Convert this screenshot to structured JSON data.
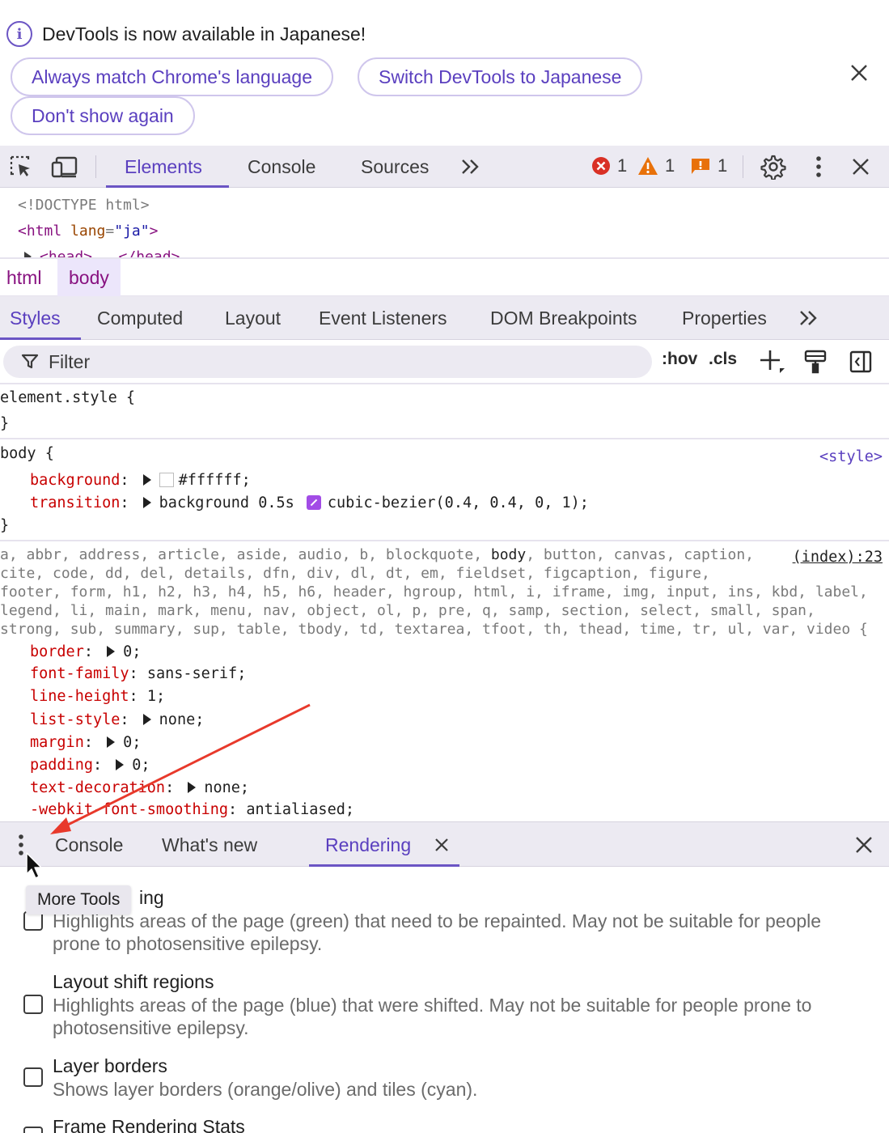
{
  "infobar": {
    "message": "DevTools is now available in Japanese!",
    "btn_always_match": "Always match Chrome's language",
    "btn_switch": "Switch DevTools to Japanese",
    "btn_dont_show": "Don't show again"
  },
  "toolbar": {
    "tabs": [
      "Elements",
      "Console",
      "Sources"
    ],
    "active_tab": "Elements",
    "errors": "1",
    "warnings": "1",
    "issues": "1"
  },
  "dom_tree": {
    "doctype": "<!DOCTYPE html>",
    "html_tag_open": "<html",
    "html_attr": "lang",
    "html_val": "\"ja\"",
    "html_tag_close": ">",
    "head_partial": "<head> … </head>"
  },
  "breadcrumb": [
    "html",
    "body"
  ],
  "subtabs": [
    "Styles",
    "Computed",
    "Layout",
    "Event Listeners",
    "DOM Breakpoints",
    "Properties"
  ],
  "filter": {
    "placeholder": "Filter",
    "hov": ":hov",
    "cls": ".cls"
  },
  "styles": {
    "element_style": "element.style {",
    "close_brace": "}",
    "body_selector": "body {",
    "body_source": "<style>",
    "body_props": [
      {
        "name": "background",
        "value": "#ffffff;"
      },
      {
        "name": "transition",
        "value_a": "background 0.5s",
        "value_b": "cubic-bezier(0.4, 0.4, 0, 1);"
      }
    ],
    "reset_source": "(index):23",
    "reset_selector_lines": [
      "a, abbr, address, article, aside, audio, b, blockquote, ",
      "body",
      ", button, canvas, caption,",
      "cite, code, dd, del, details, dfn, div, dl, dt, em, fieldset, figcaption, figure,",
      "footer, form, h1, h2, h3, h4, h5, h6, header, hgroup, html, i, iframe, img, input, ins, kbd, label,",
      "legend, li, main, mark, menu, nav, object, ol, p, pre, q, samp, section, select, small, span,",
      "strong, sub, summary, sup, table, tbody, td, textarea, tfoot, th, thead, time, tr, ul, var, video {"
    ],
    "reset_props": [
      {
        "name": "border",
        "value": "0;",
        "expand": true
      },
      {
        "name": "font-family",
        "value": "sans-serif;",
        "expand": false
      },
      {
        "name": "line-height",
        "value": "1;",
        "expand": false
      },
      {
        "name": "list-style",
        "value": "none;",
        "expand": true
      },
      {
        "name": "margin",
        "value": "0;",
        "expand": true
      },
      {
        "name": "padding",
        "value": "0;",
        "expand": true
      },
      {
        "name": "text-decoration",
        "value": "none;",
        "expand": true
      },
      {
        "name": "-webkit-font-smoothing",
        "value": "antialiased;",
        "expand": false
      }
    ]
  },
  "drawer": {
    "tabs": [
      "Console",
      "What's new",
      "Rendering"
    ],
    "active_tab": "Rendering",
    "tooltip": "More Tools"
  },
  "rendering": {
    "opt1_title_tail": "ing",
    "opt1_desc": "Highlights areas of the page (green) that need to be repainted. May not be suitable for people prone to photosensitive epilepsy.",
    "opt2_title": "Layout shift regions",
    "opt2_desc": "Highlights areas of the page (blue) that were shifted. May not be suitable for people prone to photosensitive epilepsy.",
    "opt3_title": "Layer borders",
    "opt3_desc": "Shows layer borders (orange/olive) and tiles (cyan).",
    "opt4_title": "Frame Rendering Stats"
  },
  "colors": {
    "accent": "#6b55c4",
    "error": "#d93025",
    "warning": "#e8710a",
    "issue": "#e8710a",
    "annotation_arrow": "#e8392b"
  }
}
